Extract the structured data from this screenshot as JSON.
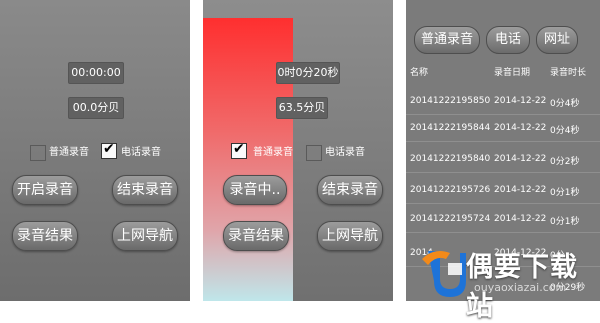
{
  "screen1": {
    "time": "00:00:00",
    "level": "00.0分贝",
    "options": [
      {
        "label": "普通录音",
        "checked": false
      },
      {
        "label": "电话录音",
        "checked": true
      }
    ],
    "buttons": {
      "start": "开启录音",
      "end": "结束录音",
      "results": "录音结果",
      "nav": "上网导航"
    }
  },
  "screen2": {
    "time": "0时0分20秒",
    "level": "63.5分贝",
    "options": [
      {
        "label": "普通录音",
        "checked": true
      },
      {
        "label": "电话录音",
        "checked": false
      }
    ],
    "buttons": {
      "recording": "录音中..",
      "end": "结束录音",
      "results": "录音结果",
      "nav": "上网导航"
    },
    "colors": {
      "bar_top": "#ff2f2f",
      "bar_bottom": "#bfe6ea"
    }
  },
  "screen3": {
    "tabs": [
      "普通录音",
      "电话",
      "网址"
    ],
    "headers": {
      "name": "名称",
      "date": "录音日期",
      "duration": "录音时长"
    },
    "rows": [
      {
        "name": "20141222195850",
        "date": "2014-12-22",
        "duration": "0分4秒"
      },
      {
        "name": "20141222195844",
        "date": "2014-12-22",
        "duration": "0分4秒"
      },
      {
        "name": "20141222195840",
        "date": "2014-12-22",
        "duration": "0分2秒"
      },
      {
        "name": "20141222195726",
        "date": "2014-12-22",
        "duration": "0分1秒"
      },
      {
        "name": "20141222195724",
        "date": "2014-12-22",
        "duration": "0分1秒"
      },
      {
        "name": "2014",
        "date": "2014-12-22",
        "duration": "0分"
      },
      {
        "name": "",
        "date": "",
        "duration": "0分29秒"
      }
    ]
  },
  "watermark": {
    "title": "偶要下载站",
    "subtitle": "ouyaoxiazai.com"
  }
}
